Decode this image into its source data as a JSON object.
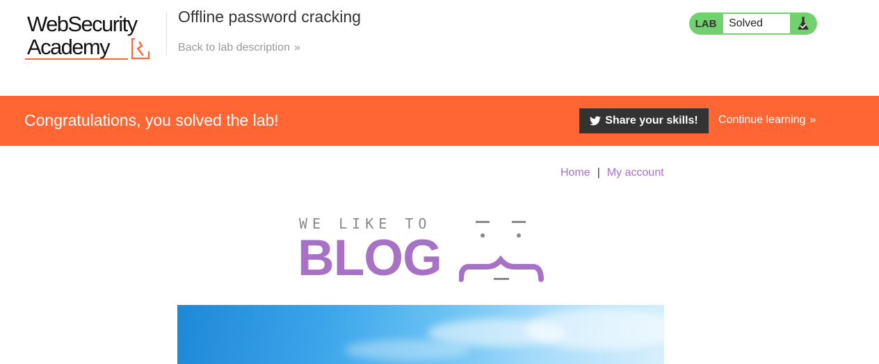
{
  "header": {
    "logo": {
      "line1": "WebSecurity",
      "line2": "Academy"
    },
    "lab_title": "Offline password cracking",
    "back_link": "Back to lab description",
    "back_chevron": "»",
    "lab_status": {
      "tag": "LAB",
      "value": "Solved",
      "icon": "flask-icon"
    },
    "colors": {
      "accent": "#ff6633",
      "status_green": "#70d16d"
    }
  },
  "banner": {
    "message": "Congratulations, you solved the lab!",
    "share_label": "Share your skills!",
    "share_icon": "twitter-icon",
    "continue_label": "Continue learning",
    "continue_chevron": "»",
    "color": "#ff6633"
  },
  "blog_nav": {
    "home": "Home",
    "separator": "|",
    "my_account": "My account",
    "link_color": "#a771c6"
  },
  "blog_logo": {
    "tagline": "WE LIKE TO",
    "word": "BLOG"
  }
}
